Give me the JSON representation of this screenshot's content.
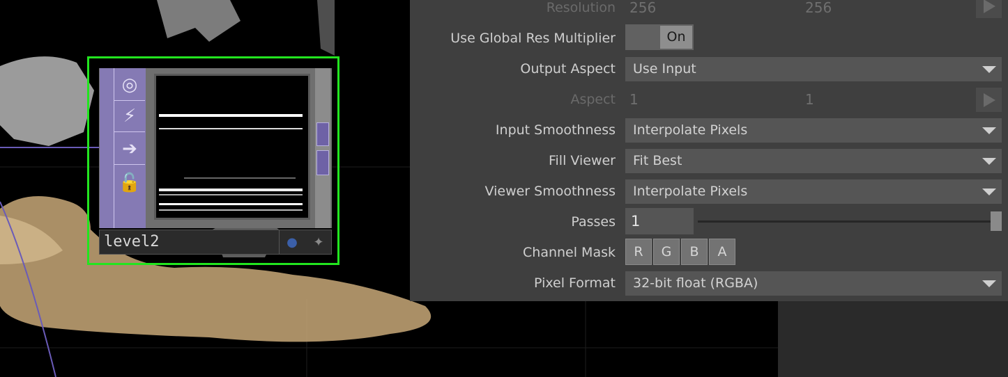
{
  "node": {
    "name": "level2"
  },
  "params": {
    "resolution": {
      "label": "Resolution",
      "w": "256",
      "h": "256"
    },
    "global_res": {
      "label": "Use Global Res Multiplier",
      "value": "On"
    },
    "output_aspect": {
      "label": "Output Aspect",
      "value": "Use Input"
    },
    "aspect": {
      "label": "Aspect",
      "w": "1",
      "h": "1"
    },
    "input_smoothness": {
      "label": "Input Smoothness",
      "value": "Interpolate Pixels"
    },
    "fill_viewer": {
      "label": "Fill Viewer",
      "value": "Fit Best"
    },
    "viewer_smoothness": {
      "label": "Viewer Smoothness",
      "value": "Interpolate Pixels"
    },
    "passes": {
      "label": "Passes",
      "value": "1",
      "slider_fraction": 1.0
    },
    "channel_mask": {
      "label": "Channel Mask",
      "channels": [
        "R",
        "G",
        "B",
        "A"
      ]
    },
    "pixel_format": {
      "label": "Pixel Format",
      "value": "32-bit float (RGBA)"
    }
  },
  "icons": {
    "node": [
      "viewer-toggle-icon",
      "bypass-icon",
      "export-arrow-icon",
      "lock-icon"
    ],
    "footer": [
      "render-flag-icon",
      "add-icon"
    ]
  },
  "colors": {
    "selection": "#22e51f",
    "node_side": "#8c7dc8",
    "panel_bg": "#3f3f3f",
    "point_cloud": "#c8a878"
  }
}
